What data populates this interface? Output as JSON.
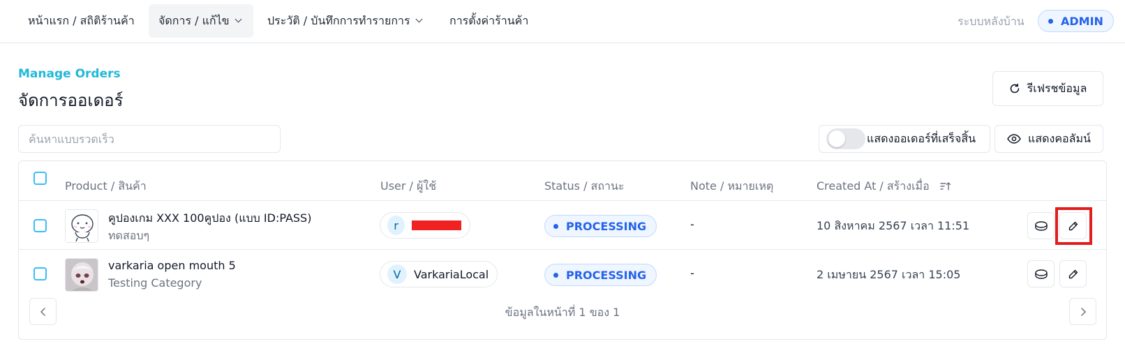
{
  "nav": {
    "items": [
      {
        "label": "หน้าแรก / สถิติร้านค้า",
        "dropdown": false
      },
      {
        "label": "จัดการ / แก้ไข",
        "dropdown": true
      },
      {
        "label": "ประวัติ / บันทึกการทำรายการ",
        "dropdown": true
      },
      {
        "label": "การตั้งค่าร้านค้า",
        "dropdown": false
      }
    ],
    "active_index": 1,
    "backend_label": "ระบบหลังบ้าน",
    "role_badge": "ADMIN"
  },
  "header": {
    "subtitle": "Manage Orders",
    "title": "จัดการออเดอร์",
    "refresh_label": "รีเฟรชข้อมูล"
  },
  "toolbar": {
    "search_placeholder": "ค้นหาแบบรวดเร็ว",
    "toggle_label": "แสดงออเดอร์ที่เสร็จสิ้น",
    "toggle_on": false,
    "columns_label": "แสดงคอลัมน์"
  },
  "table": {
    "headers": {
      "product": "Product / สินค้า",
      "user": "User / ผู้ใช้",
      "status": "Status / สถานะ",
      "note": "Note / หมายเหตุ",
      "created": "Created At / สร้างเมื่อ"
    },
    "rows": [
      {
        "product_name": "คูปองเกม XXX 100คูปอง (แบบ ID:PASS)",
        "product_category": "ทดสอบๆ",
        "user_initial": "r",
        "user_name": "",
        "user_redacted": true,
        "status": "PROCESSING",
        "note": "-",
        "created_at": "10 สิงหาคม 2567 เวลา 11:51",
        "edit_highlighted": true
      },
      {
        "product_name": "varkaria open mouth 5",
        "product_category": "Testing Category",
        "user_initial": "V",
        "user_name": "VarkariaLocal",
        "user_redacted": false,
        "status": "PROCESSING",
        "note": "-",
        "created_at": "2 เมษายน 2567 เวลา 15:05",
        "edit_highlighted": false
      }
    ],
    "pagination": "ข้อมูลในหน้าที่ 1 ของ 1"
  },
  "colors": {
    "accent": "#22b8d8",
    "status_blue": "#2563eb",
    "highlight_red": "#e11d1d"
  },
  "icons": {
    "refresh": "refresh-icon",
    "columns": "eye-icon",
    "sort": "sort-icon",
    "coin": "coin-icon",
    "edit": "pencil-icon",
    "prev": "chevron-left-icon",
    "next": "chevron-right-icon"
  }
}
